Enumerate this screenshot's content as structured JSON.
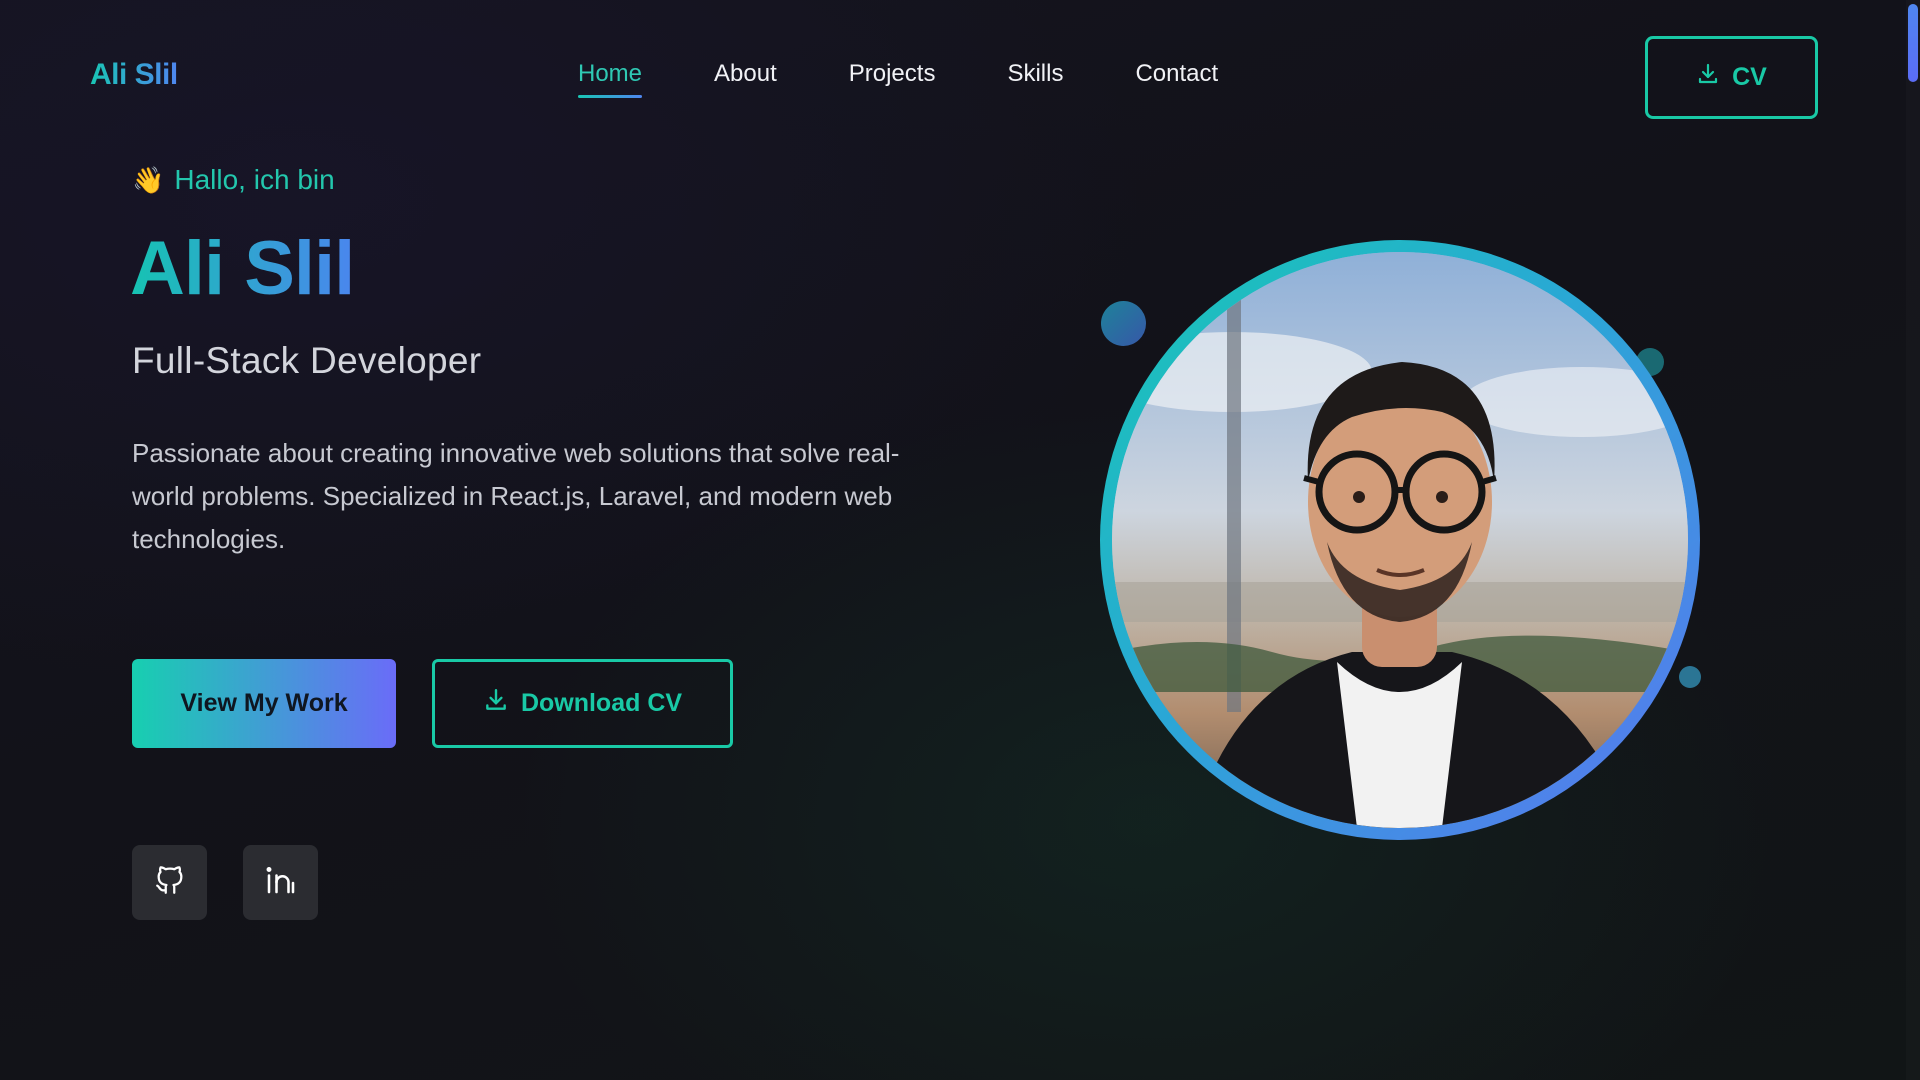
{
  "header": {
    "logo": "Ali Slil",
    "nav": [
      {
        "label": "Home",
        "active": true
      },
      {
        "label": "About",
        "active": false
      },
      {
        "label": "Projects",
        "active": false
      },
      {
        "label": "Skills",
        "active": false
      },
      {
        "label": "Contact",
        "active": false
      }
    ],
    "cv_button": {
      "label": "CV",
      "icon": "download-icon"
    }
  },
  "hero": {
    "greeting_emoji": "👋",
    "greeting": "Hallo, ich bin",
    "name": "Ali Slil",
    "role": "Full-Stack Developer",
    "description": "Passionate about creating innovative web solutions that solve real-world problems. Specialized in React.js, Laravel, and modern web technologies.",
    "primary_button": "View My Work",
    "secondary_button": {
      "label": "Download CV",
      "icon": "download-icon"
    },
    "socials": [
      {
        "name": "github",
        "icon": "github-icon"
      },
      {
        "name": "linkedin",
        "icon": "linkedin-icon"
      }
    ]
  },
  "colors": {
    "accent": "#19c9a6",
    "gradient_start": "#17cfb0",
    "gradient_end": "#6a6cf8",
    "background": "#121219"
  }
}
